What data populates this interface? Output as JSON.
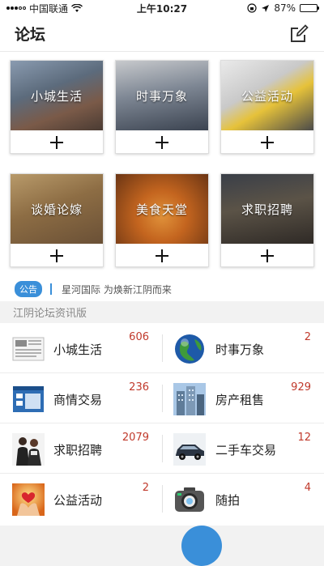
{
  "status_bar": {
    "carrier": "中国联通",
    "time": "上午10:27",
    "battery_percent": "87%",
    "battery_level": 0.87
  },
  "nav": {
    "title": "论坛",
    "edit_icon": "compose-icon"
  },
  "boards": [
    {
      "label": "小城生活",
      "plus": "+"
    },
    {
      "label": "时事万象",
      "plus": "+"
    },
    {
      "label": "公益活动",
      "plus": "+"
    },
    {
      "label": "谈婚论嫁",
      "plus": "+"
    },
    {
      "label": "美食天堂",
      "plus": "+"
    },
    {
      "label": "求职招聘",
      "plus": "+"
    }
  ],
  "notice": {
    "tag": "公告",
    "text": "星河国际 为焕新江阴而来"
  },
  "section": {
    "title": "江阴论坛资讯版"
  },
  "forum_list": [
    {
      "name": "小城生活",
      "count": "606",
      "icon": "newspaper-icon"
    },
    {
      "name": "时事万象",
      "count": "2",
      "icon": "globe-icon"
    },
    {
      "name": "商情交易",
      "count": "236",
      "icon": "window-icon"
    },
    {
      "name": "房产租售",
      "count": "929",
      "icon": "building-icon"
    },
    {
      "name": "求职招聘",
      "count": "2079",
      "icon": "people-icon"
    },
    {
      "name": "二手车交易",
      "count": "12",
      "icon": "car-icon"
    },
    {
      "name": "公益活动",
      "count": "2",
      "icon": "hands-heart-icon"
    },
    {
      "name": "随拍",
      "count": "4",
      "icon": "camera-icon"
    }
  ]
}
